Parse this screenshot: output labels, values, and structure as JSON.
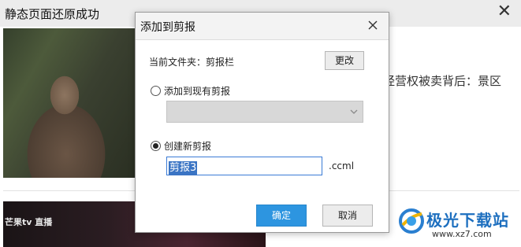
{
  "background": {
    "page_title": "静态页面还原成功",
    "headline_fragment": "经营权被卖背后：景区",
    "tv_logo_text": "芒果tv 直播",
    "watermark": {
      "name": "极光下载站",
      "url": "www.xz7.com"
    }
  },
  "dialog": {
    "title": "添加到剪报",
    "current_folder_label": "当前文件夹：剪报栏",
    "change_button": "更改",
    "option_existing": "添加到现有剪报",
    "existing_select_value": "",
    "option_new": "创建新剪报",
    "selected_option": "new",
    "new_name_value": "剪报3",
    "extension": ".ccml",
    "ok_button": "确定",
    "cancel_button": "取消"
  },
  "colors": {
    "primary_button": "#2d95e0",
    "selection": "#3a74c4",
    "watermark_blue": "#1d6fbf"
  }
}
